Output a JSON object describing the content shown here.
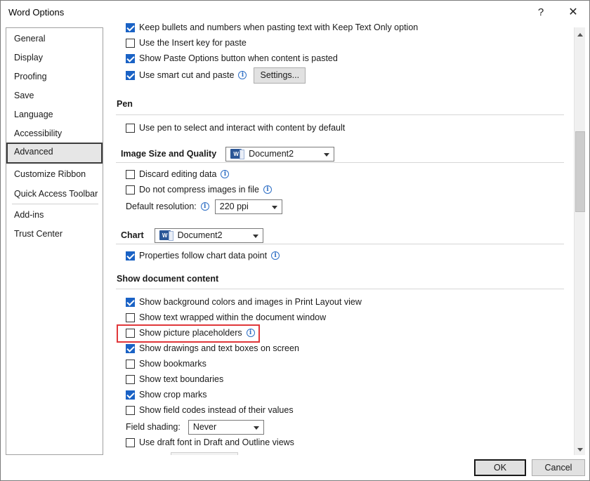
{
  "window": {
    "title": "Word Options",
    "help": "?",
    "close": "✕"
  },
  "sidebar": {
    "items": [
      {
        "label": "General"
      },
      {
        "label": "Display"
      },
      {
        "label": "Proofing"
      },
      {
        "label": "Save"
      },
      {
        "label": "Language"
      },
      {
        "label": "Accessibility"
      },
      {
        "label": "Advanced",
        "selected": true
      },
      {
        "label": "Customize Ribbon"
      },
      {
        "label": "Quick Access Toolbar"
      },
      {
        "label": "Add-ins"
      },
      {
        "label": "Trust Center"
      }
    ]
  },
  "cut_copy_paste": {
    "keep_bullets": {
      "label": "Keep bullets and numbers when pasting text with Keep Text Only option",
      "checked": true
    },
    "use_insert_key": {
      "label": "Use the Insert key for paste",
      "checked": false
    },
    "show_paste_options": {
      "label": "Show Paste Options button when content is pasted",
      "checked": true
    },
    "smart_cut": {
      "label": "Use smart cut and paste",
      "checked": true
    },
    "settings_button": "Settings..."
  },
  "pen": {
    "title": "Pen",
    "use_pen": {
      "label": "Use pen to select and interact with content by default",
      "checked": false
    }
  },
  "image_size": {
    "title": "Image Size and Quality",
    "document": "Document2",
    "discard_editing": {
      "label": "Discard editing data",
      "checked": false
    },
    "no_compress": {
      "label": "Do not compress images in file",
      "checked": false
    },
    "resolution_label": "Default resolution:",
    "resolution_value": "220 ppi"
  },
  "chart": {
    "title": "Chart",
    "document": "Document2",
    "properties_follow": {
      "label": "Properties follow chart data point",
      "checked": true
    }
  },
  "show_doc_content": {
    "title": "Show document content",
    "items": [
      {
        "label": "Show background colors and images in Print Layout view",
        "checked": true
      },
      {
        "label": "Show text wrapped within the document window",
        "checked": false
      },
      {
        "label": "Show picture placeholders",
        "checked": false,
        "info": true
      },
      {
        "label": "Show drawings and text boxes on screen",
        "checked": true
      },
      {
        "label": "Show bookmarks",
        "checked": false
      },
      {
        "label": "Show text boundaries",
        "checked": false
      },
      {
        "label": "Show crop marks",
        "checked": true
      },
      {
        "label": "Show field codes instead of their values",
        "checked": false
      }
    ],
    "field_shading_label": "Field shading:",
    "field_shading_value": "Never",
    "draft_font": {
      "label": "Use draft font in Draft and Outline views",
      "checked": false
    }
  },
  "footer": {
    "ok": "OK",
    "cancel": "Cancel"
  }
}
